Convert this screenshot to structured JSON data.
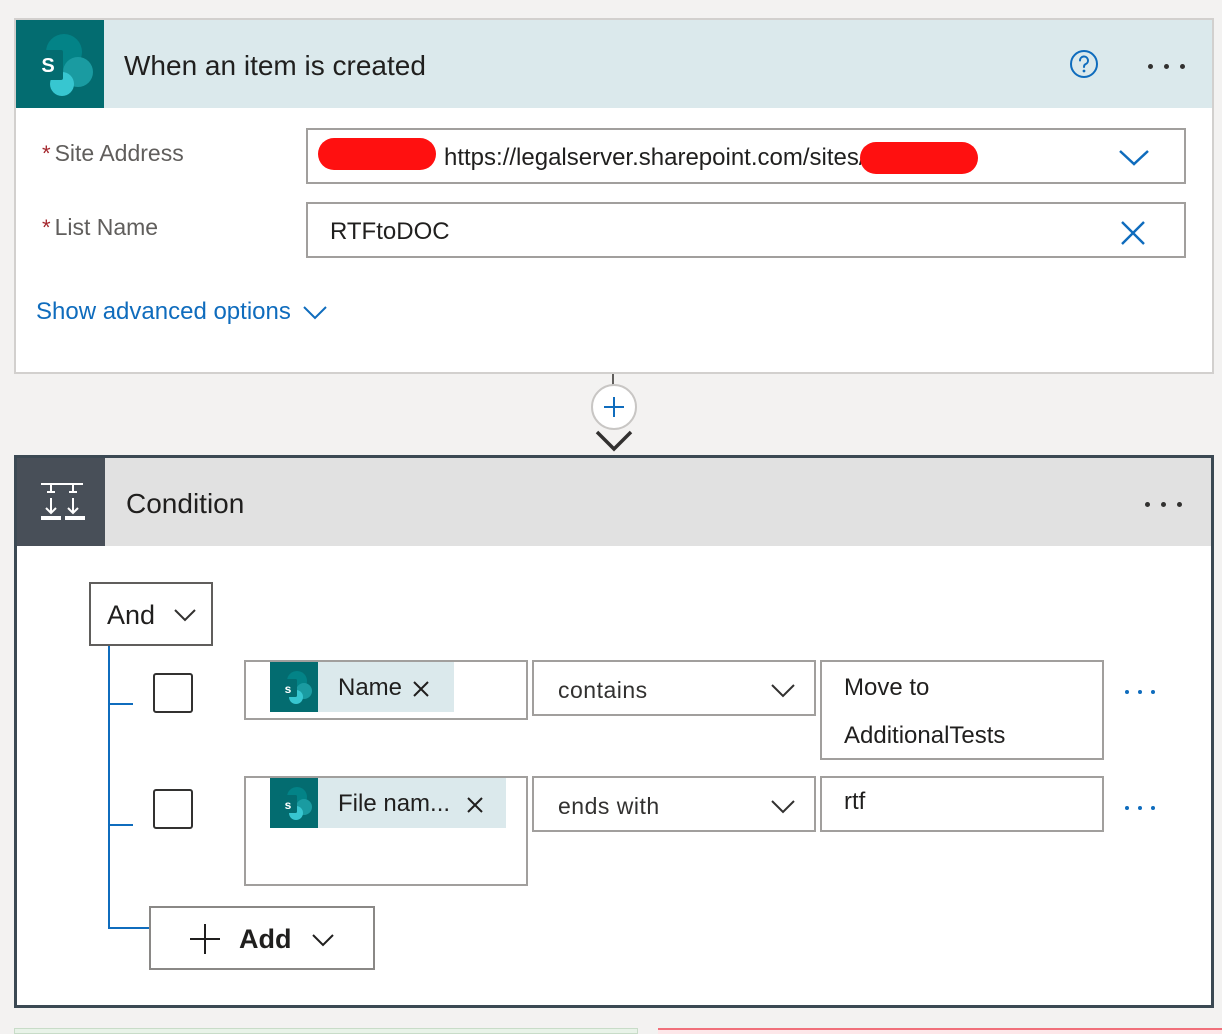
{
  "trigger": {
    "title": "When an item is created",
    "site_address_label": "Site Address",
    "site_address_value": "https://legalserver.sharepoint.com/sites/",
    "list_name_label": "List Name",
    "list_name_value": "RTFtoDOC",
    "required_marker": "*",
    "advanced_link": "Show advanced options",
    "app_icon_letter": "S",
    "help_icon": "help-circle-icon",
    "more_icon": "more-ellipsis-icon"
  },
  "connector": {
    "plus_icon": "plus-icon",
    "arrow_icon": "arrow-down-icon"
  },
  "condition": {
    "title": "Condition",
    "group_operator": "And",
    "rows": [
      {
        "token_label": "Name",
        "operator": "contains",
        "value_lines": [
          "Move to",
          "AdditionalTests"
        ]
      },
      {
        "token_label": "File nam...",
        "operator": "ends with",
        "value_lines": [
          "rtf"
        ]
      }
    ],
    "add_label": "Add",
    "token_icon_letter": "s"
  },
  "colors": {
    "sharepoint_teal": "#036c70",
    "trigger_header": "#dbe9ec",
    "condition_header": "#e1e1e1",
    "condition_tile": "#484f58",
    "link_blue": "#0f6cbd",
    "redaction_red": "#ff1010"
  }
}
